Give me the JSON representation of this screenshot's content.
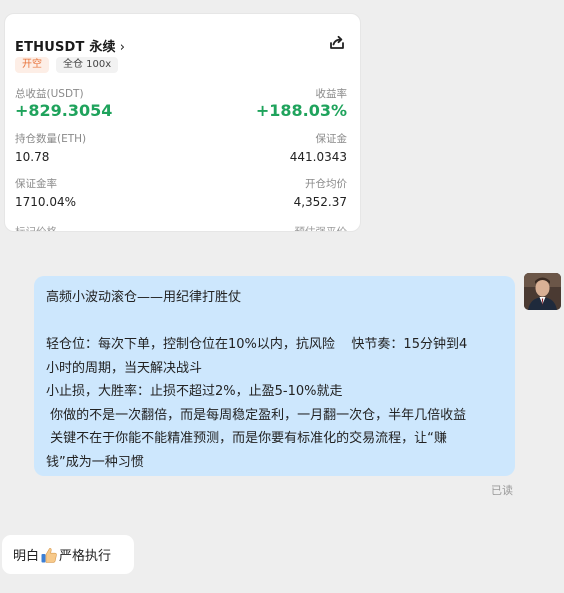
{
  "card": {
    "pair": "ETHUSDT 永续",
    "chevron": "›",
    "share_icon": "share-icon",
    "tag_open": "开空",
    "tag_margin": "全仓 100x",
    "total_pnl_label": "总收益(USDT)",
    "total_pnl_value": "+829.3054",
    "roi_label": "收益率",
    "roi_value": "+188.03%",
    "position_qty_label": "持仓数量(ETH)",
    "position_qty_value": "10.78",
    "margin_label": "保证金",
    "margin_value": "441.0343",
    "margin_ratio_label": "保证金率",
    "margin_ratio_value": "1710.04%",
    "avg_open_label": "开仓均价",
    "avg_open_value": "4,352.37",
    "cut_left_label": "标记价格",
    "cut_right_label": "预估强平价"
  },
  "message_right": {
    "lines": [
      "高频小波动滚仓——用纪律打胜仗",
      "",
      "轻仓位：每次下单，控制仓位在10%以内，抗风险    快节奏：15分钟到4",
      "小时的周期，当天解决战斗",
      "小止损，大胜率：止损不超过2%，止盈5-10%就走",
      " 你做的不是一次翻倍，而是每周稳定盈利，一月翻一次仓，半年几倍收益",
      " 关键不在于你能不能精准预测，而是你要有标准化的交易流程，让“赚",
      "钱”成为一种习惯"
    ],
    "read_status": "已读"
  },
  "message_left": {
    "text_before": "明白",
    "emoji": "thumbs-up-icon",
    "text_after": "严格执行"
  },
  "colors": {
    "profit_green": "#1fa35c",
    "bubble_blue": "#cde7fd",
    "tag_orange": "#e8743b"
  }
}
